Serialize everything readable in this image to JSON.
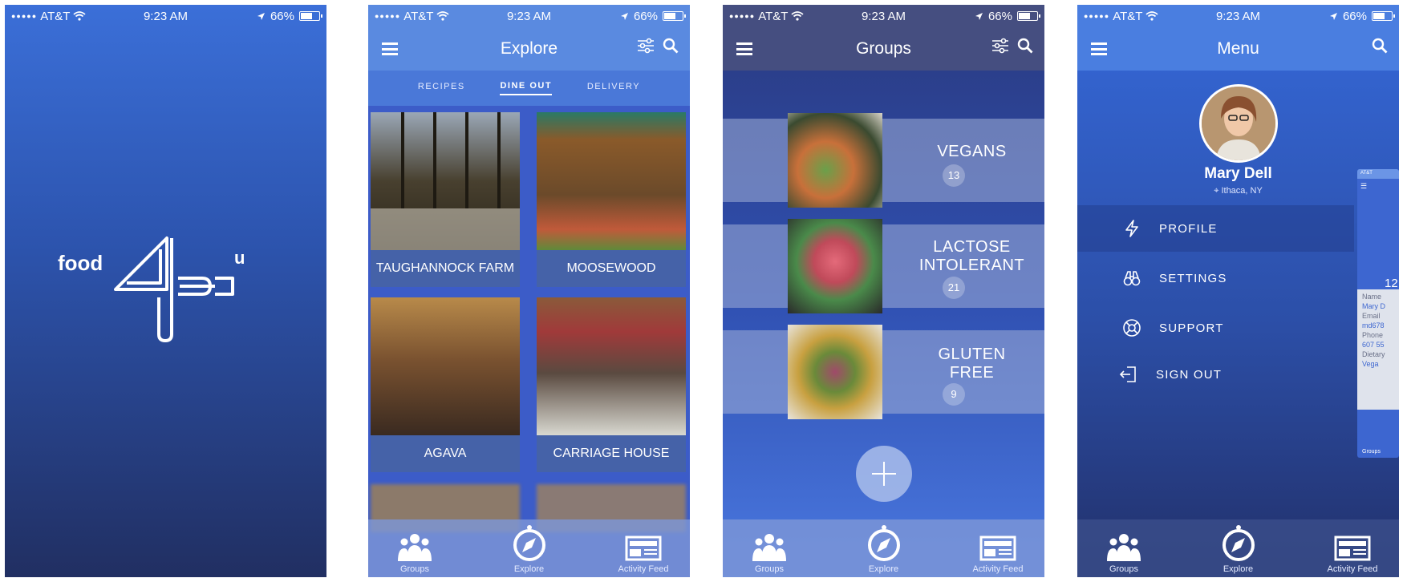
{
  "status": {
    "carrier": "AT&T",
    "time": "9:23 AM",
    "battery": "66%"
  },
  "splash": {
    "logo_left": "food",
    "logo_right": "u"
  },
  "explore": {
    "title": "Explore",
    "tabs": [
      {
        "label": "RECIPES",
        "active": false
      },
      {
        "label": "DINE OUT",
        "active": true
      },
      {
        "label": "DELIVERY",
        "active": false
      }
    ],
    "cards": [
      {
        "name": "TAUGHANNOCK FARM"
      },
      {
        "name": "MOOSEWOOD"
      },
      {
        "name": "AGAVA"
      },
      {
        "name": "CARRIAGE HOUSE"
      }
    ]
  },
  "groups": {
    "title": "Groups",
    "items": [
      {
        "line1": "VEGANS",
        "line2": "",
        "count": "13"
      },
      {
        "line1": "LACTOSE",
        "line2": "INTOLERANT",
        "count": "21"
      },
      {
        "line1": "GLUTEN",
        "line2": "FREE",
        "count": "9"
      }
    ]
  },
  "menu": {
    "title": "Menu",
    "user": {
      "name": "Mary Dell",
      "location": "Ithaca, NY"
    },
    "items": [
      {
        "label": "PROFILE",
        "icon": "bolt-icon",
        "active": true
      },
      {
        "label": "SETTINGS",
        "icon": "binoculars-icon",
        "active": false
      },
      {
        "label": "SUPPORT",
        "icon": "lifebuoy-icon",
        "active": false
      },
      {
        "label": "SIGN OUT",
        "icon": "sign-out-icon",
        "active": false
      }
    ],
    "peek": {
      "carrier": "AT&T",
      "count": "12",
      "name_label": "Name",
      "name_value": "Mary D",
      "email_label": "Email",
      "email_value": "md678",
      "phone_label": "Phone",
      "phone_value": "607 55",
      "dietary_label": "Dietary",
      "dietary_value": "Vega",
      "tab": "Groups"
    }
  },
  "tabbar": {
    "groups": "Groups",
    "explore": "Explore",
    "feed": "Activity Feed"
  },
  "colors": {
    "primary": "#3c64c8",
    "navy": "#212f62",
    "accent_light": "#5a8ae0"
  }
}
